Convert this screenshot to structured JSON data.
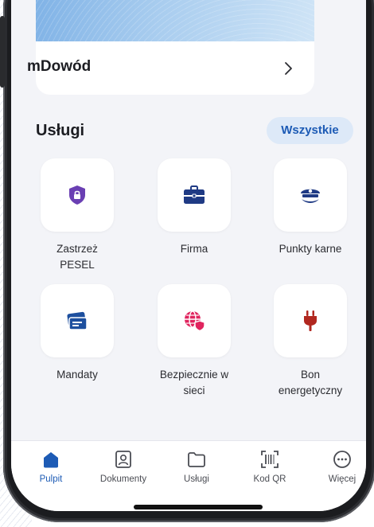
{
  "document_card": {
    "title": "mDowód",
    "chevron_icon": "chevron-right-icon"
  },
  "services": {
    "title": "Usługi",
    "all_button": "Wszystkie",
    "tiles": [
      {
        "label": "Zastrzeż\nPESEL",
        "icon": "shield-lock-icon",
        "color": "#6a3fb3"
      },
      {
        "label": "Firma",
        "icon": "briefcase-icon",
        "color": "#1f3a84"
      },
      {
        "label": "Punkty karne",
        "icon": "police-cap-icon",
        "color": "#1f3a84"
      },
      {
        "label": "Mandaty",
        "icon": "ticket-cards-icon",
        "color": "#1d4f9e"
      },
      {
        "label": "Bezpiecznie w\nsieci",
        "icon": "globe-shield-icon",
        "color": "#e0245e"
      },
      {
        "label": "Bon\nenergetyczny",
        "icon": "power-plug-icon",
        "color": "#b1271f"
      }
    ]
  },
  "tabbar": {
    "active": "Pulpit",
    "active_color": "#1d5bb5",
    "items": [
      {
        "label": "Pulpit",
        "icon": "home-icon"
      },
      {
        "label": "Dokumenty",
        "icon": "id-card-icon"
      },
      {
        "label": "Usługi",
        "icon": "folder-icon"
      },
      {
        "label": "Kod QR",
        "icon": "qr-scan-icon"
      },
      {
        "label": "Więcej",
        "icon": "more-dots-icon"
      }
    ]
  }
}
